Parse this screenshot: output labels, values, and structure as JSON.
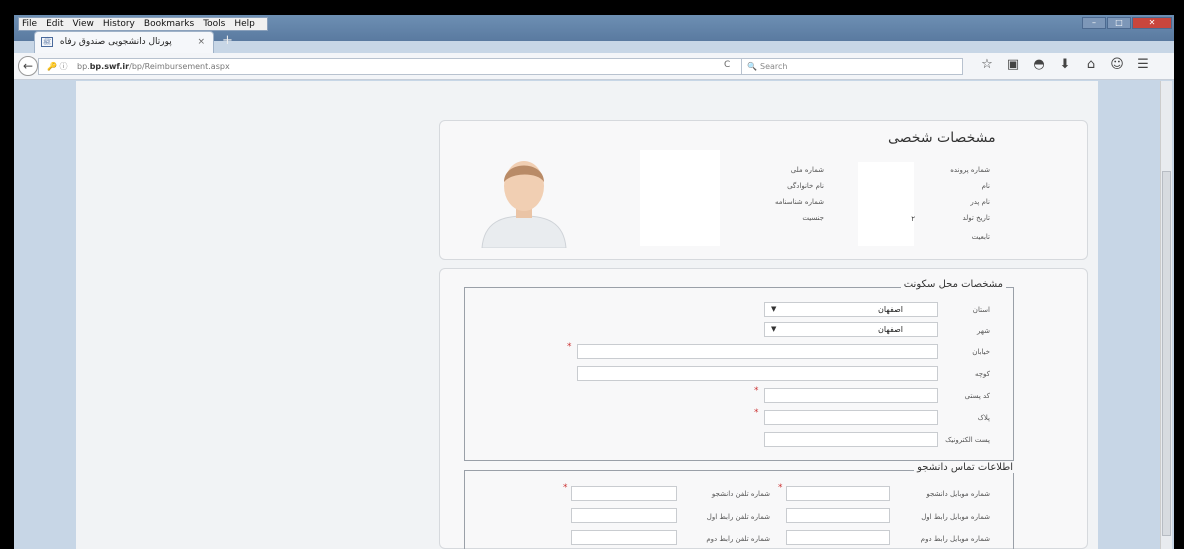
{
  "browser": {
    "menu": [
      "File",
      "Edit",
      "View",
      "History",
      "Bookmarks",
      "Tools",
      "Help"
    ],
    "tab_title": "پورتال دانشجویی صندوق رفاه",
    "tab_close": "×",
    "new_tab": "+",
    "url_host": "bp.swf.ir",
    "url_path": "/bp/Reimbursement.aspx",
    "url_prefix": "bp.",
    "search_placeholder": "Search"
  },
  "personal": {
    "title": "مشخصات شخصی",
    "labels_right": [
      "شماره پرونده",
      "نام",
      "نام پدر",
      "تاریخ تولد",
      "تابعیت"
    ],
    "labels_mid": [
      "شماره ملی",
      "نام خانوادگی",
      "شماره شناسنامه",
      "جنسیت"
    ],
    "stray_digit": "۲"
  },
  "residence": {
    "legend": "مشخصات محل سکونت",
    "province_label": "استان",
    "province_value": "اصفهان",
    "city_label": "شهر",
    "city_value": "اصفهان",
    "street_label": "خیابان",
    "alley_label": "کوچه",
    "postal_label": "کد پستی",
    "plate_label": "پلاک",
    "email_label": "پست الکترونیک",
    "required_mark": "*"
  },
  "contact": {
    "legend": "اطلاعات تماس دانشجو",
    "student_mobile": "شماره موبایل دانشجو",
    "student_phone": "شماره تلفن دانشجو",
    "mobile_rel1": "شماره موبایل رابط اول",
    "phone_rel1": "شماره تلفن رابط اول",
    "mobile_rel2": "شماره موبایل رابط دوم",
    "phone_rel2": "شماره تلفن رابط دوم",
    "required_mark": "*"
  }
}
